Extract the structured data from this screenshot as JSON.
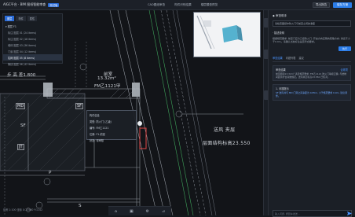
{
  "header": {
    "app_title": "AIGC平台 · BIM 图纸智能审查",
    "version_tag": "测试版",
    "nav": [
      "CAD图纸审查",
      "构件识别结果",
      "楼层模型预览"
    ],
    "btn_secondary": "导出报告",
    "btn_primary": "保存方案"
  },
  "left_panel": {
    "tabs": [
      "图层",
      "构件",
      "属性"
    ],
    "tree": [
      {
        "label": "▾ 楼层 F1",
        "root": true
      },
      {
        "label": "标注 图层 01 (24 items)",
        "root": false
      },
      {
        "label": "标注 图层 02 (18 items)",
        "root": false
      },
      {
        "label": "墙体 图层 03 (36 items)",
        "root": false
      },
      {
        "label": "门窗 图层 04 (12 items)",
        "root": false
      },
      {
        "label": "柱网 图层 05 (8 items)",
        "root": false
      },
      {
        "label": "管线 图层 06 (42 items)",
        "root": false
      }
    ],
    "selected_index": 5
  },
  "drawing": {
    "step_label": "步 高 差1.800",
    "room_name": "前室",
    "room_area": "13.32m²",
    "door_code": "FM乙1121甲",
    "tag_sf": "SF",
    "tag_md": "MD",
    "tag_jt": "JT",
    "shaft_label": "送风 夹层",
    "elevation_label": "层面结构标高23.550",
    "grid_p": "P",
    "grid_s": "S"
  },
  "popup": {
    "lines": [
      "构件信息",
      "类型: 防火门 (乙级)",
      "编号: FM乙1121",
      "位置: F1-前室",
      "状态: 待审核"
    ]
  },
  "bottom_bar": {
    "left_text": "比例 1:100  坐标 X:23580 Y:1142"
  },
  "right_panel": {
    "section_title": "◆ 审查助手",
    "input_text": "请检查图纸中防火门与前室之间的净距",
    "desc_label": "· 描述说明",
    "desc_text": "根据规范要求, 前室门应为乙级防火门, 开启方向应朝向疏散方向; 净宽不小于0.9m。请确认当前标注是否符合要求。",
    "run_button": "执行",
    "tabs": [
      "审查结果",
      "问题列表",
      "建议"
    ],
    "card1_title": "审查结果",
    "card1_body": "前室面积13.32m² 满足规范要求; FM乙1121 防火门等级正确, 与楼梯间距离符合疏散规定。送风夹层标高23.550 已核对。",
    "card1_tag": "合规项",
    "card2_title": "1. 问题提示",
    "card2_body": "SF 送风井与 MD 门洞之间净距为 0.85m, 小于规范要求 0.9m, 建议调整。",
    "input_placeholder": "输入问题, 按回车发送..."
  }
}
